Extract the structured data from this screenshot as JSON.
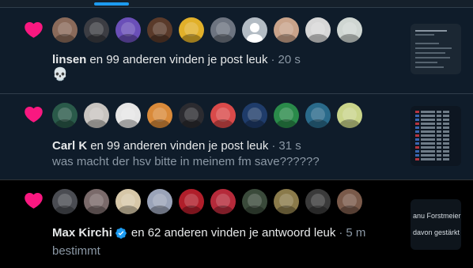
{
  "colors": {
    "accent": "#1d9bf0",
    "like_heart": "#f91880",
    "secondary_text": "#8b98a5",
    "primary_text": "#e7e9ea"
  },
  "notifications": [
    {
      "type": "like",
      "icon": "heart-icon",
      "name": "linsen",
      "action_text": "en 99 anderen vinden je post leuk",
      "separator": "·",
      "time": "20 s",
      "post_text": "💀",
      "avatar_colors": [
        "#8a6a5a",
        "#3c3d43",
        "#6a4fb8",
        "#5a3a2a",
        "#e1b02a",
        "#6d7480",
        "default",
        "#c9a38a",
        "#d7d7d7",
        "#cfd6d2"
      ]
    },
    {
      "type": "like",
      "icon": "heart-icon",
      "name": "Carl K",
      "action_text": "en 99 anderen vinden je post leuk",
      "separator": "·",
      "time": "31 s",
      "post_text": "was macht der hsv bitte in meinem fm save??????",
      "avatar_colors": [
        "#2a5a4a",
        "#c8c4c0",
        "#e6e6e6",
        "#d98a3a",
        "#2b2b30",
        "#d94a4a",
        "#1f3c6a",
        "#2a8a4a",
        "#2a6a8a",
        "#c9d48a"
      ]
    },
    {
      "type": "like",
      "icon": "heart-icon",
      "name": "Max Kirchi",
      "verified": true,
      "action_text": "en 62 anderen vinden je antwoord leuk",
      "separator": "·",
      "time": "5 m",
      "post_text": "bestimmt",
      "thumbnail_lines": [
        "anu Forstmeier",
        "davon gestärkt ra"
      ],
      "avatar_colors": [
        "#4a4c52",
        "#7a6a6a",
        "#d6c7a8",
        "#9aa3b8",
        "#b01e2a",
        "#b52a3a",
        "#3a4a3a",
        "#8a7a4a",
        "#3a3a3a",
        "#7a5a4a"
      ]
    }
  ]
}
